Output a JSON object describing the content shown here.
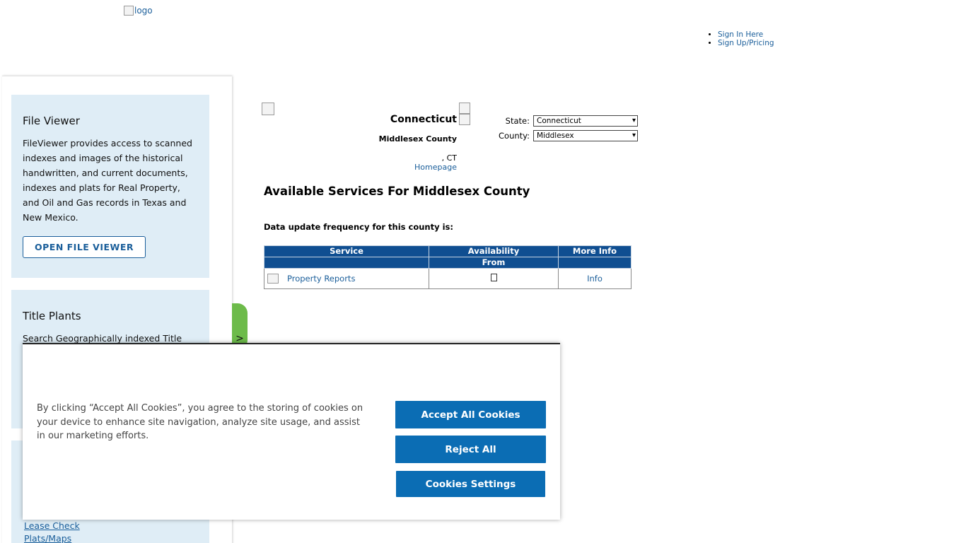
{
  "header": {
    "logo_alt": "logo",
    "auth_links": [
      "Sign In Here",
      "Sign Up/Pricing"
    ]
  },
  "sidebar": {
    "file_viewer": {
      "title": "File Viewer",
      "description": "FileViewer provides access to scanned indexes and images of the historical handwritten, and current documents, indexes and plats for Real Property, and Oil and Gas records in Texas and New Mexico.",
      "button_label": "OPEN FILE VIEWER"
    },
    "title_plants": {
      "title": "Title Plants",
      "description": "Search Geographically indexed Title"
    },
    "links": [
      "Lease Check",
      "Plats/Maps"
    ],
    "toggle_label": ">"
  },
  "main": {
    "state_name": "Connecticut",
    "county_name": "Middlesex County",
    "ct_line": ", CT",
    "homepage_link": "Homepage",
    "state_label": "State:",
    "state_value": "Connecticut",
    "county_label": "County:",
    "county_value": "Middlesex",
    "heading": "Available Services For Middlesex County",
    "update_frequency": "Data update frequency for this county is:",
    "table": {
      "headers": [
        "Service",
        "Availability",
        "More Info"
      ],
      "subheader": "From",
      "rows": [
        {
          "service": "Property Reports",
          "more_info": "Info"
        }
      ]
    }
  },
  "cookie": {
    "text": "By clicking “Accept All Cookies”, you agree to the storing of cookies on your device to enhance site navigation, analyze site usage, and assist in our marketing efforts.",
    "accept_label": "Accept All Cookies",
    "reject_label": "Reject All",
    "settings_label": "Cookies Settings"
  },
  "colors": {
    "brand_blue": "#0b6db4",
    "table_header": "#0f4e91",
    "sidebar_card": "#dfedf6",
    "toggle_green": "#6dbb4a"
  }
}
